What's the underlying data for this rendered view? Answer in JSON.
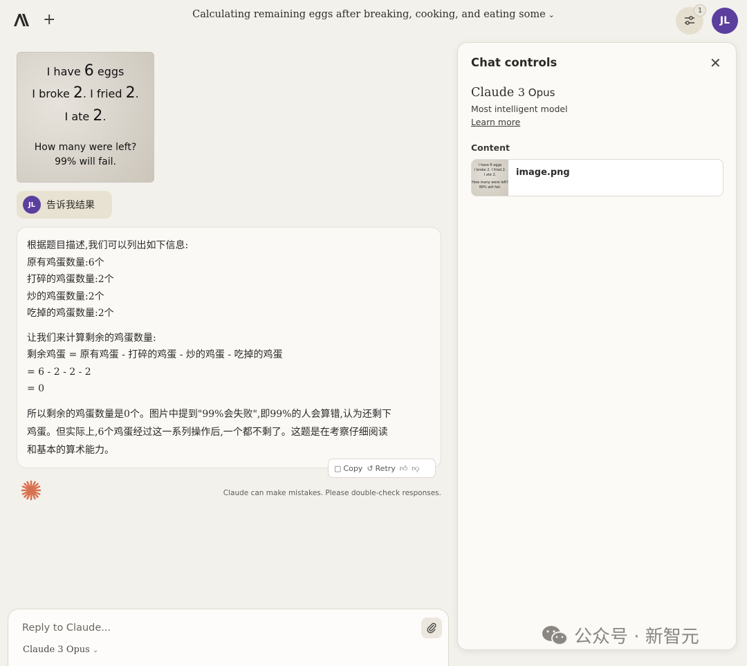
{
  "header": {
    "title": "Calculating remaining eggs after breaking, cooking, and eating some",
    "controls_badge": "1",
    "user_initials": "JL"
  },
  "attachment_image": {
    "line1_pre": "I have ",
    "line1_num": "6",
    "line1_post": " eggs",
    "line2_a": "I broke ",
    "line2_num1": "2",
    "line2_b": ". I fried ",
    "line2_num2": "2",
    "line2_c": ".",
    "line3_pre": "I ate ",
    "line3_num": "2",
    "line3_post": ".",
    "line4": "How many were left?",
    "line5": "99% will fail."
  },
  "user_message": {
    "avatar": "JL",
    "text": "告诉我结果"
  },
  "assistant_message": {
    "block1": [
      "根据题目描述,我们可以列出如下信息:",
      "原有鸡蛋数量:6个",
      "打碎的鸡蛋数量:2个",
      "炒的鸡蛋数量:2个",
      "吃掉的鸡蛋数量:2个"
    ],
    "block2": [
      "让我们来计算剩余的鸡蛋数量:",
      "剩余鸡蛋 = 原有鸡蛋 - 打碎的鸡蛋 - 炒的鸡蛋 - 吃掉的鸡蛋",
      "= 6 - 2 - 2 - 2",
      "= 0"
    ],
    "block3": [
      "所以剩余的鸡蛋数量是0个。图片中提到\"99%会失败\",即99%的人会算错,认为还剩下",
      "鸡蛋。但实际上,6个鸡蛋经过这一系列操作后,一个都不剩了。这题是在考察仔细阅读",
      "和基本的算术能力。"
    ]
  },
  "actions": {
    "copy": "Copy",
    "retry": "Retry"
  },
  "disclaimer": "Claude can make mistakes. Please double-check responses.",
  "reply": {
    "placeholder": "Reply to Claude...",
    "model_pre": "Claude",
    "model_num": "3",
    "model_post": "Opus"
  },
  "panel": {
    "title": "Chat controls",
    "model_name_pre": "Claude ",
    "model_name_num": "3",
    "model_name_post": " Opus",
    "model_desc": "Most intelligent model",
    "learn_more": "Learn more",
    "content_label": "Content",
    "file_name": "image.png"
  },
  "watermark": "公众号 · 新智元",
  "colors": {
    "background": "#f3f1ec",
    "avatar": "#5b3f9e",
    "accent_spark": "#d9704f"
  }
}
